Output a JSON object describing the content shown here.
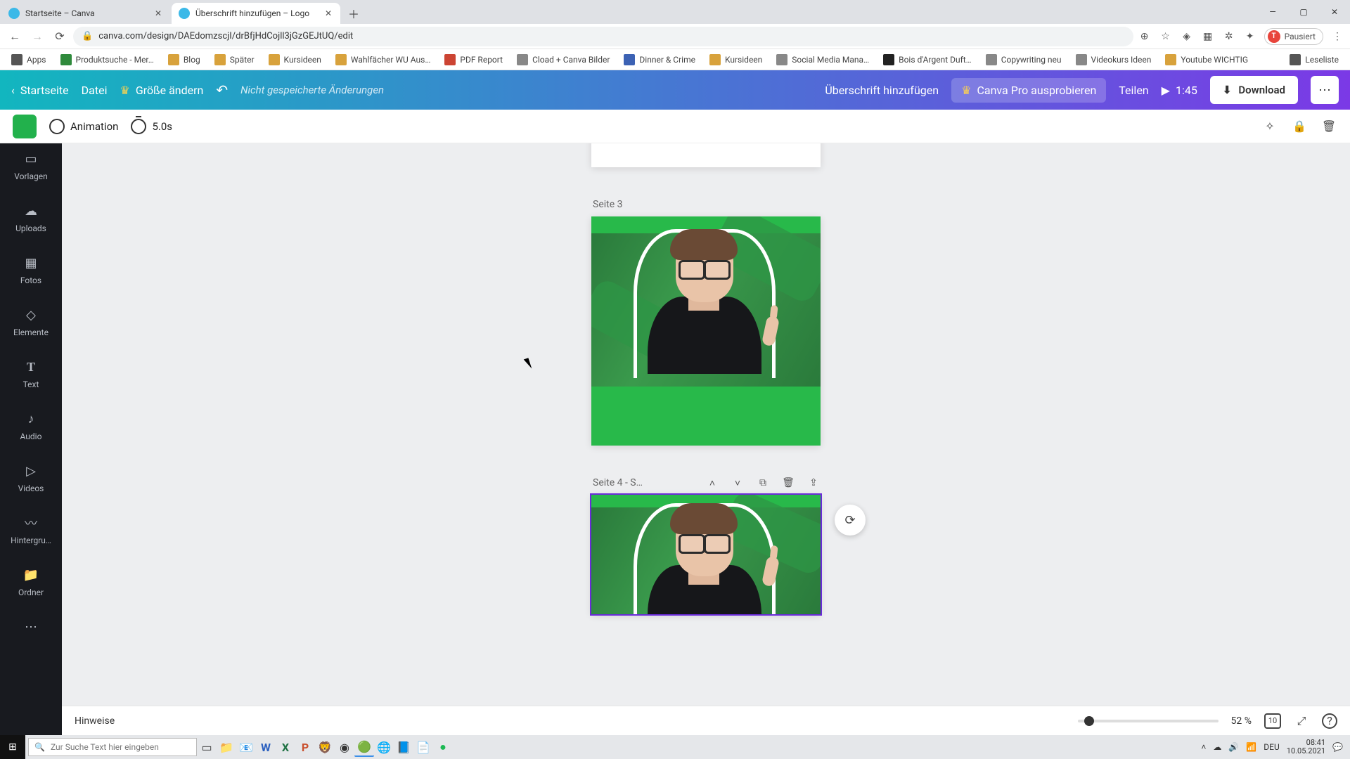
{
  "browser": {
    "tabs": [
      {
        "title": "Startseite – Canva"
      },
      {
        "title": "Überschrift hinzufügen – Logo"
      }
    ],
    "window_controls": {
      "min": "—",
      "max": "▢",
      "close": "✕"
    },
    "url": "canva.com/design/DAEdomzscjI/drBfjHdCojll3jGzGEJtUQ/edit",
    "account_chip": "Pausiert",
    "account_initial": "T",
    "bookmarks": [
      "Apps",
      "Produktsuche - Mer…",
      "Blog",
      "Später",
      "Kursideen",
      "Wahlfächer WU Aus…",
      "PDF Report",
      "Cload + Canva Bilder",
      "Dinner & Crime",
      "Kursideen",
      "Social Media Mana…",
      "Bois d'Argent Duft…",
      "Copywriting neu",
      "Videokurs Ideen",
      "Youtube WICHTIG"
    ],
    "reading_list": "Leseliste"
  },
  "canva_header": {
    "home": "Startseite",
    "file": "Datei",
    "resize": "Größe ändern",
    "status": "Nicht gespeicherte Änderungen",
    "doc_title": "Überschrift hinzufügen",
    "try_pro": "Canva Pro ausprobieren",
    "share": "Teilen",
    "play_time": "1:45",
    "download": "Download"
  },
  "context_bar": {
    "color": "#22b14c",
    "animation": "Animation",
    "duration": "5.0s"
  },
  "side_nav": [
    "Vorlagen",
    "Uploads",
    "Fotos",
    "Elemente",
    "Text",
    "Audio",
    "Videos",
    "Hintergru…",
    "Ordner"
  ],
  "pages": {
    "p3_label": "Seite 3",
    "p4_label": "Seite 4 - S…"
  },
  "footer": {
    "notes": "Hinweise",
    "zoom": "52 %",
    "page_count": "10"
  },
  "taskbar": {
    "search_placeholder": "Zur Suche Text hier eingeben",
    "time": "08:41",
    "date": "10.05.2021",
    "lang": "DEU"
  }
}
